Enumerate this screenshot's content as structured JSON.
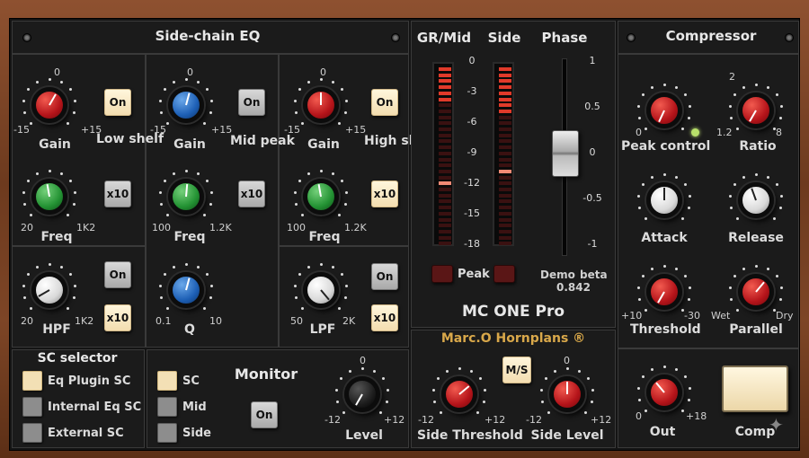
{
  "sidechain_eq": {
    "title": "Side-chain EQ",
    "low": {
      "gain_label": "Gain",
      "gain_min": "-15",
      "gain_mid": "0",
      "gain_max": "+15",
      "freq_label": "Freq",
      "freq_min": "20",
      "freq_max": "1K2",
      "on": "On",
      "x10": "x10",
      "band": "Low shelf"
    },
    "mid": {
      "gain_label": "Gain",
      "gain_min": "-15",
      "gain_mid": "0",
      "gain_max": "+15",
      "freq_label": "Freq",
      "freq_min": "100",
      "freq_max": "1.2K",
      "on": "On",
      "x10": "x10",
      "band": "Mid peak",
      "q_label": "Q",
      "q_min": "0.1",
      "q_max": "10"
    },
    "high": {
      "gain_label": "Gain",
      "gain_min": "-15",
      "gain_mid": "0",
      "gain_max": "+15",
      "freq_label": "Freq",
      "freq_min": "100",
      "freq_max": "1.2K",
      "on": "On",
      "x10": "x10",
      "band": "High shelf"
    },
    "hpf": {
      "label": "HPF",
      "min": "20",
      "max": "1K2",
      "on": "On",
      "x10": "x10"
    },
    "lpf": {
      "label": "LPF",
      "min": "50",
      "max": "2K",
      "on": "On",
      "x10": "x10"
    }
  },
  "sc_selector": {
    "title": "SC selector",
    "options": [
      "Eq Plugin SC",
      "Internal Eq SC",
      "External SC"
    ]
  },
  "monitor": {
    "title": "Monitor",
    "options": [
      "SC",
      "Mid",
      "Side"
    ],
    "on": "On",
    "level_label": "Level",
    "level_min": "-12",
    "level_mid": "0",
    "level_max": "+12"
  },
  "meters": {
    "gr_label": "GR/Mid",
    "side_label": "Side",
    "phase_label": "Phase",
    "scale": [
      "0",
      "-3",
      "-6",
      "-9",
      "-12",
      "-15",
      "-18"
    ],
    "peak": "Peak",
    "phase_scale": [
      "1",
      "0.5",
      "0",
      "-0.5",
      "-1"
    ],
    "demo": "Demo",
    "beta": "beta",
    "version": "0.842",
    "product": "MC ONE Pro"
  },
  "brand": {
    "name": "Marc.O Hornplans ®",
    "ms": "M/S",
    "side_threshold": "Side Threshold",
    "st_min": "-12",
    "st_max": "+12",
    "side_level": "Side Level",
    "sl_min": "-12",
    "sl_mid": "0",
    "sl_max": "+12"
  },
  "compressor": {
    "title": "Compressor",
    "peak_label": "Peak control",
    "peak_min": "0",
    "ratio_label": "Ratio",
    "ratio_min": "1.2",
    "ratio_mid": "2",
    "ratio_max": "8",
    "attack": "Attack",
    "release": "Release",
    "threshold": "Threshold",
    "th_min": "+10",
    "th_max": "-30",
    "parallel": "Parallel",
    "wet": "Wet",
    "dry": "Dry",
    "out": "Out",
    "out_min": "0",
    "out_max": "+18",
    "comp": "Comp"
  },
  "colors": {
    "red": "#c8181e",
    "blue": "#2a6fc4",
    "green": "#2aa03a",
    "lit": "#f3ddb0"
  }
}
